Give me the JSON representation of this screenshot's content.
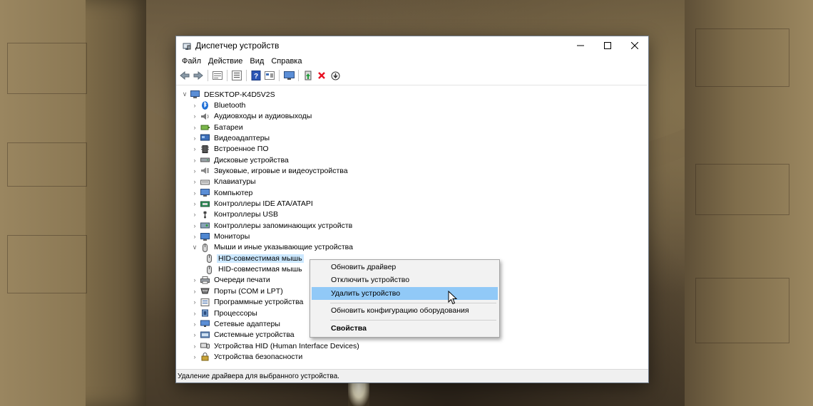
{
  "window": {
    "title": "Диспетчер устройств",
    "controls": [
      "minimize",
      "maximize",
      "close"
    ]
  },
  "menu": [
    "Файл",
    "Действие",
    "Вид",
    "Справка"
  ],
  "toolbar": {
    "icons": [
      "back-arrow-icon",
      "forward-arrow-icon",
      "properties-sheet-icon",
      "list-view-icon",
      "help-icon",
      "device-view-icon",
      "monitor-scan-icon",
      "update-driver-icon",
      "remove-device-icon",
      "disable-device-icon"
    ]
  },
  "tree": {
    "root": "DESKTOP-K4D5V2S",
    "items": [
      {
        "label": "Bluetooth",
        "icon": "bluetooth-icon"
      },
      {
        "label": "Аудиовходы и аудиовыходы",
        "icon": "speaker-icon"
      },
      {
        "label": "Батареи",
        "icon": "battery-icon"
      },
      {
        "label": "Видеоадаптеры",
        "icon": "display-adapter-icon"
      },
      {
        "label": "Встроенное ПО",
        "icon": "firmware-icon"
      },
      {
        "label": "Дисковые устройства",
        "icon": "disk-drive-icon"
      },
      {
        "label": "Звуковые, игровые и видеоустройства",
        "icon": "sound-icon"
      },
      {
        "label": "Клавиатуры",
        "icon": "keyboard-icon"
      },
      {
        "label": "Компьютер",
        "icon": "computer-icon"
      },
      {
        "label": "Контроллеры IDE ATA/ATAPI",
        "icon": "ide-controller-icon"
      },
      {
        "label": "Контроллеры USB",
        "icon": "usb-icon"
      },
      {
        "label": "Контроллеры запоминающих устройств",
        "icon": "storage-controller-icon"
      },
      {
        "label": "Мониторы",
        "icon": "monitor-icon"
      },
      {
        "label": "Мыши и иные указывающие устройства",
        "icon": "mouse-icon",
        "expanded": true
      },
      {
        "label": "HID-совместимая мышь",
        "icon": "mouse-icon",
        "child": true,
        "selected": true
      },
      {
        "label": "HID-совместимая мышь",
        "icon": "mouse-icon",
        "child": true
      },
      {
        "label": "Очереди печати",
        "icon": "printer-icon"
      },
      {
        "label": "Порты (COM и LPT)",
        "icon": "port-icon"
      },
      {
        "label": "Программные устройства",
        "icon": "software-device-icon"
      },
      {
        "label": "Процессоры",
        "icon": "processor-icon"
      },
      {
        "label": "Сетевые адаптеры",
        "icon": "network-adapter-icon"
      },
      {
        "label": "Системные устройства",
        "icon": "system-device-icon"
      },
      {
        "label": "Устройства HID (Human Interface Devices)",
        "icon": "hid-icon"
      },
      {
        "label": "Устройства безопасности",
        "icon": "security-device-icon"
      }
    ]
  },
  "context_menu": {
    "items": [
      {
        "label": "Обновить драйвер"
      },
      {
        "label": "Отключить устройство"
      },
      {
        "label": "Удалить устройство",
        "highlighted": true
      },
      {
        "label": "Обновить конфигурацию оборудования"
      },
      {
        "label": "Свойства",
        "bold": true
      }
    ]
  },
  "status": "Удаление драйвера для выбранного устройства.",
  "colors": {
    "selection": "#cce8ff",
    "menu_highlight": "#91c9f7",
    "remove_red": "#e81123"
  }
}
